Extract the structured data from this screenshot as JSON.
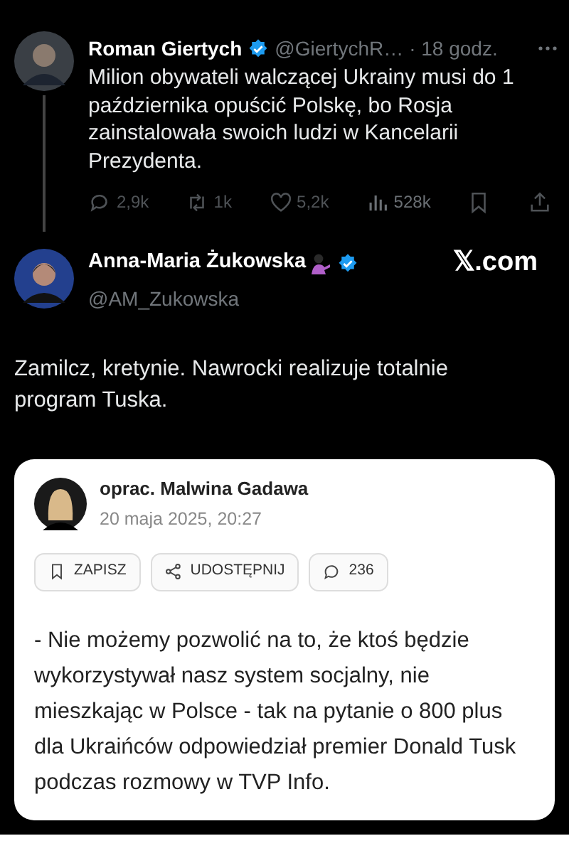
{
  "tweet": {
    "name": "Roman Giertych",
    "verified": true,
    "handle": "@GiertychR…",
    "time": "· 18 godz.",
    "text": "Milion obywateli walczącej Ukrainy musi do 1 października opuścić Polskę, bo Rosja zainstalowała swoich ludzi w Kancelarii Prezydenta.",
    "stats": [
      {
        "kind": "reply",
        "count": "2,9k"
      },
      {
        "kind": "repost",
        "count": "1k"
      },
      {
        "kind": "like",
        "count": "5,2k"
      },
      {
        "kind": "views",
        "count": "528k"
      },
      {
        "kind": "bookmark"
      },
      {
        "kind": "share"
      }
    ]
  },
  "reply": {
    "name": "Anna-Maria Żukowska",
    "verified": true,
    "handle": "@AM_Zukowska",
    "site": "𝕏.com",
    "text": "Zamilcz, kretynie. Nawrocki realizuje totalnie program Tuska."
  },
  "article": {
    "author": "oprac. Malwina Gadawa",
    "date": "20 maja 2025, 20:27",
    "buttons": [
      {
        "kind": "save",
        "label": "ZAPISZ"
      },
      {
        "kind": "share",
        "label": "UDOSTĘPNIJ"
      },
      {
        "kind": "comments",
        "label": "236"
      }
    ],
    "text": "- Nie możemy pozwolić na to, że ktoś będzie wykorzystywał nasz system socjalny, nie mieszkając w Polsce - tak na pytanie o 800 plus dla Ukraińców odpowiedział premier Donald Tusk podczas rozmowy w TVP Info."
  }
}
